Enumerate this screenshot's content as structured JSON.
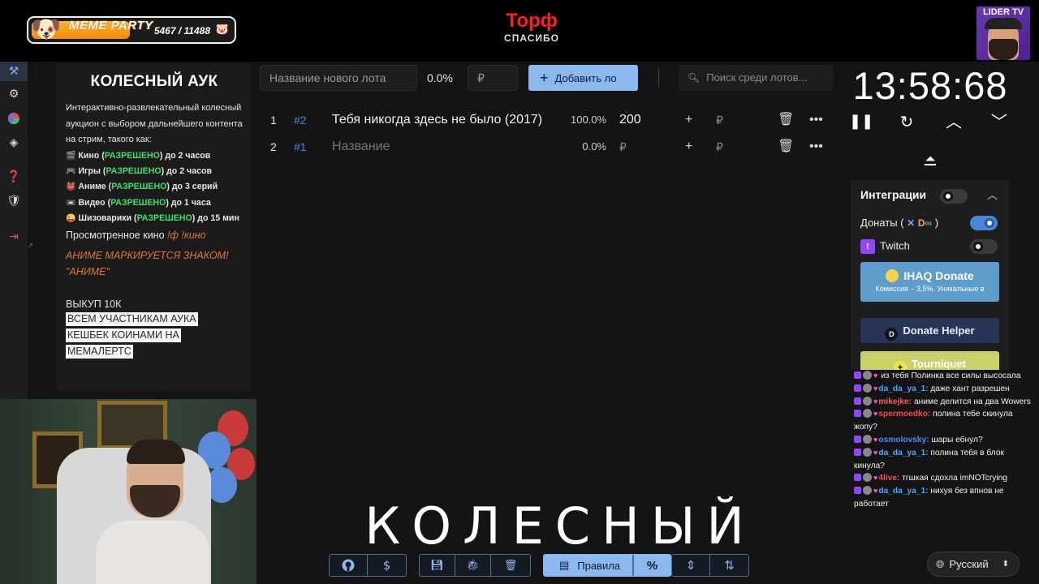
{
  "overlay": {
    "meme_party": {
      "title": "MEME PARTY",
      "count": "5467 / 11488",
      "progress": 0.475
    },
    "stream_title": "Торф",
    "stream_subtitle": "СПАСИБО",
    "channel_badge": "LIDER TV",
    "subtitle_caption": "КОЛЕСНЫЙ"
  },
  "sidebar": {
    "items": [
      {
        "icon": "gavel-icon",
        "active": true
      },
      {
        "icon": "gear-icon"
      },
      {
        "icon": "wheel-chart-icon"
      },
      {
        "icon": "layers-icon"
      },
      {
        "icon": "help-icon"
      },
      {
        "icon": "shield-icon"
      },
      {
        "icon": "logout-icon"
      }
    ]
  },
  "description": {
    "title": "КОЛЕСНЫЙ АУК",
    "intro": "Интерактивно-развлекательный колесный аукцион с выбором дальнейшего контента на стрим, такого как:",
    "rules": [
      {
        "icon": "🎬",
        "name": "Кино",
        "status": "РАЗРЕШЕНО",
        "limit": "до 2 часов"
      },
      {
        "icon": "🎮",
        "name": "Игры",
        "status": "РАЗРЕШЕНО",
        "limit": "до 2 часов"
      },
      {
        "icon": "👹",
        "name": "Аниме",
        "status": "РАЗРЕШЕНО",
        "limit": "до 3 серий"
      },
      {
        "icon": "📼",
        "name": "Видео",
        "status": "РАЗРЕШЕНО",
        "limit": "до 1 часа"
      },
      {
        "icon": "😜",
        "name": "Шизоварики",
        "status": "РАЗРЕШЕНО",
        "limit": "до 15 мин"
      }
    ],
    "watched_label": "Просмотренное кино",
    "watched_cmd": "!ф !кино",
    "anime_note": "АНИМЕ МАРКИРУЕТСЯ ЗНАКОМ! \"АНИМЕ\"",
    "buyout": "ВЫКУП 10К",
    "highlights": [
      "ВСЕМ УЧАСТНИКАМ АУКА",
      "КЕШБЕК КОИНАМИ НА",
      "МЕМАЛЕРТС"
    ]
  },
  "toolbar": {
    "new_lot_placeholder": "Название нового лота",
    "percent": "0.0%",
    "currency": "₽",
    "add_label": "Добавить ло",
    "search_placeholder": "Поиск среди лотов..."
  },
  "lots": [
    {
      "num": "1",
      "id": "#2",
      "name": "Тебя никогда здесь не было (2017)",
      "placeholder": false,
      "pct": "100.0%",
      "amount": "200"
    },
    {
      "num": "2",
      "id": "#1",
      "name": "Название",
      "placeholder": true,
      "pct": "0.0%",
      "amount": ""
    }
  ],
  "lot_currency": "₽",
  "timer": {
    "value": "13:58:68"
  },
  "integrations": {
    "title": "Интеграции",
    "donations_label": "Донаты (",
    "donations_close": ")",
    "twitch_label": "Twitch",
    "ihaq_title": "IHAQ Donate",
    "ihaq_sub": "Комиссия – 3,5%. Уникальные в",
    "donate_helper": "Donate Helper",
    "tourniquet": "Tourniquet"
  },
  "chat": [
    {
      "user": "",
      "text": "из тебя Полинка все силы высосала",
      "color": "#ff8c3a"
    },
    {
      "user": "da_da_ya_1:",
      "text": "даже хант разрешен",
      "color": "#4aa8ff"
    },
    {
      "user": "mikejke:",
      "text": "аниме делится на два Wowers",
      "color": "#ff5a5a"
    },
    {
      "user": "spermoedko:",
      "text": "полина тебе скинула жопу?",
      "color": "#ff4a4a"
    },
    {
      "user": "osmolovsky:",
      "text": "шары ебнул?",
      "color": "#4a8aff"
    },
    {
      "user": "da_da_ya_1:",
      "text": "полина тебя в блок кинула?",
      "color": "#4aa8ff"
    },
    {
      "user": "4live:",
      "text": "тгшкая сдохла imNOTcrying",
      "color": "#ff4a4a"
    },
    {
      "user": "da_da_ya_1:",
      "text": "нихуя без впнов не работает",
      "color": "#4aa8ff"
    }
  ],
  "bottom": {
    "rules_label": "Правила",
    "percent_symbol": "%"
  },
  "language": {
    "label": "Русский"
  }
}
